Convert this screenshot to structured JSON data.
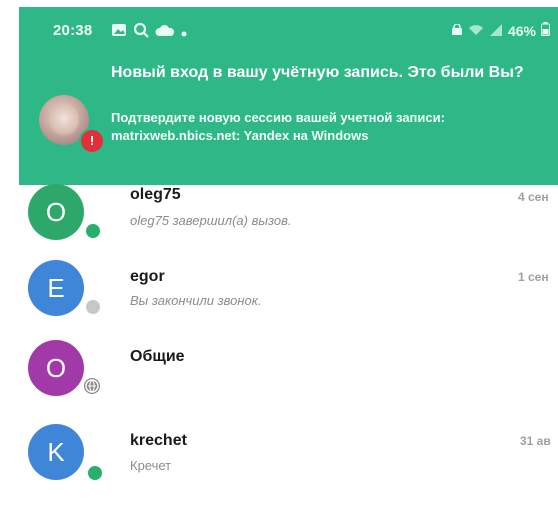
{
  "status_bar": {
    "time": "20:38",
    "battery": "46%"
  },
  "notification": {
    "title": "Новый вход в вашу учётную запись. Это были Вы?",
    "body": "Подтвердите новую сессию вашей учетной записи: matrixweb.nbics.net: Yandex на Windows",
    "badge": "!"
  },
  "chats": [
    {
      "name": "oleg75",
      "avatar_letter": "O",
      "avatar_color": "#2ea86a",
      "preview": "oleg75 завершил(а) вызов.",
      "date": "4 сен",
      "presence": "online"
    },
    {
      "name": "egor",
      "avatar_letter": "E",
      "avatar_color": "#3f86d8",
      "preview": "Вы закончили звонок.",
      "date": "1 сен",
      "presence": "offline"
    },
    {
      "name": "Общие",
      "avatar_letter": "O",
      "avatar_color": "#a13aa8",
      "preview": "",
      "date": "",
      "presence": "world"
    },
    {
      "name": "krechet",
      "avatar_letter": "K",
      "avatar_color": "#3f86d8",
      "preview": "Кречет",
      "date": "31 ав",
      "presence": "online"
    }
  ],
  "colors": {
    "notification_bg": "#2eb887",
    "online": "#27b06b",
    "offline": "#c7c7c7"
  },
  "icons": [
    "image-icon",
    "search-icon",
    "cloud-icon",
    "dot-icon",
    "lock-icon",
    "wifi-icon",
    "signal-icon",
    "battery-icon"
  ]
}
